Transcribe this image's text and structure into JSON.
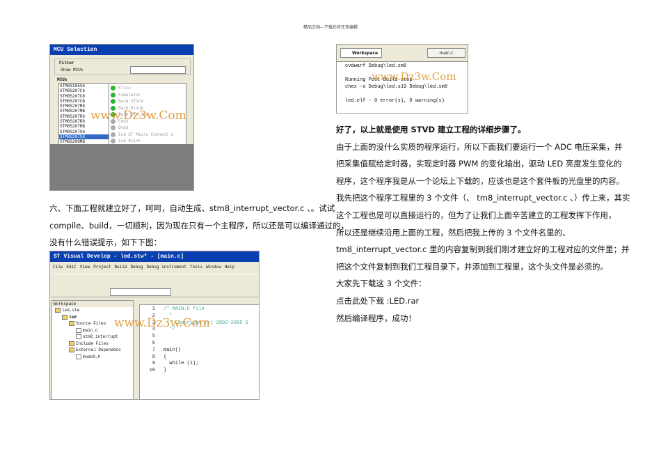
{
  "header": "精品文档---下载后可任意编辑",
  "mcu": {
    "title": "MCU Selection",
    "filter": "Filter",
    "show": "Show MCUs",
    "group": "MCUs",
    "list": [
      "STM8S105S6",
      "STM8S207C6",
      "STM8S207C8",
      "STM8S207CB",
      "STM8S207M8",
      "STM8S207MB",
      "STM8S207R6",
      "STM8S207R8",
      "STM8S207RB",
      "STM8S207S6",
      "STM8S207S8",
      "STM8S208MB"
    ],
    "selected": 10,
    "tools": [
      {
        "name": "STice",
        "on": true
      },
      {
        "name": "Simulator",
        "on": true
      },
      {
        "name": "Swim STice",
        "on": true
      },
      {
        "name": "Swim Rlink",
        "on": true
      },
      {
        "name": "Swim ST-Link",
        "on": true
      },
      {
        "name": "Emu3",
        "on": false
      },
      {
        "name": "Dvp3",
        "on": false
      },
      {
        "name": "Icd ST Micro Connect o",
        "on": false
      },
      {
        "name": "Icd Rlink",
        "on": false
      }
    ]
  },
  "watermark": "www.Dz3w.Com",
  "left_para": [
    "六、下面工程就建立好了，呵呵，自动生成、stm8_interrupt_vector.c 、。试试",
    "compile、build，一切顺利，因为现在只有一个主程序，所以还是可以编译通过的，",
    "没有什么错误提示，如下下图："
  ],
  "ide": {
    "title": "ST Visual Develop - led.stw* - [main.c]",
    "menu": [
      "File",
      "Edit",
      "View",
      "Project",
      "Build",
      "Debug",
      "Debug instrument",
      "Tools",
      "Window",
      "Help"
    ],
    "workspace": "Workspace",
    "tree": [
      {
        "t": "led.stw",
        "l": 0
      },
      {
        "t": "led",
        "l": 1
      },
      {
        "t": "Source Files",
        "l": 2
      },
      {
        "t": "main.c",
        "l": 3
      },
      {
        "t": "stm8_interrupt",
        "l": 3
      },
      {
        "t": "Include Files",
        "l": 2
      },
      {
        "t": "External Dependenc",
        "l": 2
      },
      {
        "t": "mods0.h",
        "l": 3
      }
    ],
    "code": [
      "/* MAIN.C file",
      "  *",
      "  * Copyright (c) 2002-2005 S",
      "  */",
      "",
      "",
      "main()",
      "{",
      "  while (1);",
      "}"
    ]
  },
  "output": {
    "tab_workspace": "Workspace",
    "tab_main": "main.c",
    "lines": [
      "cvdwarf Debug\\led.sm8",
      "",
      "Running Post-Build step",
      "chex -o Debug\\led.s19 Debug\\led.sm8",
      "",
      "led.elf - 0 error(s), 0 warning(s)"
    ]
  },
  "right_para": [
    "好了，以上就是使用 STVD 建立工程的详细步骤了。",
    "由于上面的没什么实质的程序运行，所以下面我们要运行一个 ADC 电压采集，并",
    "把采集值赋给定时器，实现定时器 PWM 的变化输出，驱动 LED 亮度发生变化的",
    "程序，这个程序我是从一个论坛上下载的，应该也是这个套件板的光盘里的内容。",
    "我先把这个程序工程里的 3 个文件（、 tm8_interrupt_vector.c 、）传上来，其实",
    "这个工程也是可以直接运行的，但为了让我们上面辛苦建立的工程发挥下作用，",
    "所以还是继续沿用上面的工程，然后把我上传的 3 个文件名里的、",
    "tm8_interrupt_vector.c 里的内容复制到我们刚才建立好的工程对应的文件里；并",
    "把这个文件复制到我们工程目录下，并添加到工程里，这个头文件是必须的。",
    "大家先下载这 3 个文件：",
    "点击此处下载 :LED.rar",
    "然后编译程序，成功！"
  ]
}
